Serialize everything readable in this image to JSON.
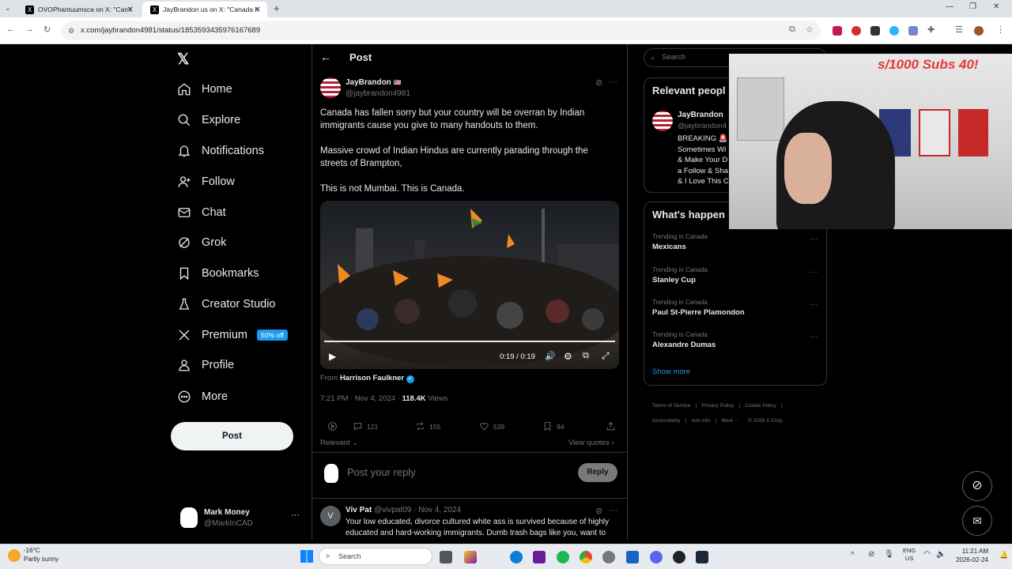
{
  "browser": {
    "tabs": [
      {
        "title": "OVOPhantuumsca on X: \"Can't"
      },
      {
        "title": "JayBrandon us on X: \"Canada h"
      }
    ],
    "url": "x.com/jaybrandon4981/status/1853593435976167689"
  },
  "nav": {
    "items": [
      {
        "label": "Home",
        "icon": "home-icon"
      },
      {
        "label": "Explore",
        "icon": "search-icon"
      },
      {
        "label": "Notifications",
        "icon": "bell-icon"
      },
      {
        "label": "Follow",
        "icon": "person-add-icon"
      },
      {
        "label": "Chat",
        "icon": "mail-icon"
      },
      {
        "label": "Grok",
        "icon": "grok-icon"
      },
      {
        "label": "Bookmarks",
        "icon": "bookmark-icon"
      },
      {
        "label": "Creator Studio",
        "icon": "flask-icon"
      },
      {
        "label": "Premium",
        "icon": "x-logo-icon"
      },
      {
        "label": "Profile",
        "icon": "person-icon"
      },
      {
        "label": "More",
        "icon": "more-circle-icon"
      }
    ],
    "premium_badge": "50% off",
    "post_button": "Post",
    "account": {
      "name": "Mark Money",
      "handle": "@MarkInCAD"
    }
  },
  "post": {
    "header": "Post",
    "author": {
      "name": "JayBrandon",
      "flag": "🇺🇸",
      "handle": "@jaybrandon4981"
    },
    "paragraphs": [
      "Canada has fallen sorry but your country will be overran by Indian immigrants cause you give to many handouts to them.",
      "Massive crowd of Indian Hindus are currently parading through the streets of Brampton,",
      "This is not Mumbai. This is Canada."
    ],
    "video": {
      "time": "0:19 / 0:19",
      "progress": 1.0
    },
    "from_label": "From",
    "from_name": "Harrison Faulkner",
    "timestamp": "7:21 PM · Nov 4, 2024 ·",
    "views_count": "118.4K",
    "views_label": "Views",
    "actions": {
      "replies": "121",
      "reposts": "155",
      "likes": "539",
      "bookmarks": "94"
    },
    "sort_label": "Relevant",
    "view_quotes": "View quotes",
    "reply_placeholder": "Post your reply",
    "reply_button": "Reply"
  },
  "reply": {
    "initial": "V",
    "name": "Viv Pat",
    "handle": "@vivpat09",
    "date": "· Nov 4, 2024",
    "text": "Your low educated, divorce cultured white ass is survived because of highly educated and hard-working immigrants. Dumb trash bags like you, want to"
  },
  "sidebar": {
    "search_placeholder": "Search",
    "relevant_title": "Relevant peopl",
    "relevant_person": {
      "name": "JayBrandon",
      "handle": "@jaybrandon4",
      "bio": [
        "BREAKING 🚨",
        "Sometimes Wi",
        "& Make Your D",
        "a Follow & Sha",
        "& I Love This C"
      ]
    },
    "happening_title": "What's happen",
    "trends": [
      {
        "meta": "Trending in Canada",
        "name": "Mexicans"
      },
      {
        "meta": "Trending in Canada",
        "name": "Stanley Cup"
      },
      {
        "meta": "Trending in Canada",
        "name": "Paul St-Pierre Plamondon"
      },
      {
        "meta": "Trending in Canada",
        "name": "Alexandre Dumas"
      }
    ],
    "show_more": "Show more",
    "footer": [
      "Terms of Service",
      "Privacy Policy",
      "Cookie Policy",
      "Accessibility",
      "Ads info",
      "More ···",
      "© 2026 X Corp."
    ]
  },
  "overlay": {
    "text": "s/1000 Subs 40!"
  },
  "taskbar": {
    "weather_temp": "-16°C",
    "weather_desc": "Partly sunny",
    "search": "Search",
    "lang": "ENG",
    "region": "US",
    "time": "11:21 AM",
    "date": "2026-02-24"
  },
  "colors": {
    "accent": "#1d9bf0",
    "bg": "#000000",
    "muted": "#71767b"
  }
}
